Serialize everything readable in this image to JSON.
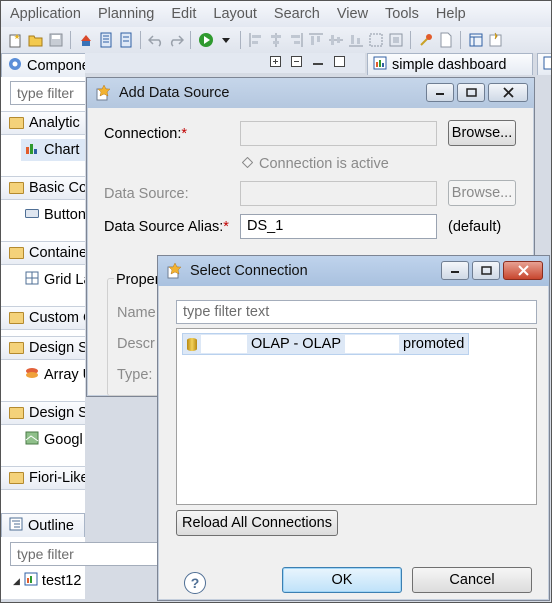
{
  "menu": [
    "Application",
    "Planning",
    "Edit",
    "Layout",
    "Search",
    "View",
    "Tools",
    "Help"
  ],
  "toolbar_icons": [
    "new-icon",
    "open-icon",
    "save-icon",
    "deploy-icon",
    "grid-icon",
    "list-icon",
    "undo-icon",
    "redo-icon",
    "run-icon",
    "dropdown-icon",
    "align-left-icon",
    "align-center-icon",
    "align-right-icon",
    "align-top-icon",
    "align-middle-icon",
    "align-bottom-icon",
    "resize-icon",
    "fit-icon",
    "pin-icon",
    "page-icon",
    "layout-icon",
    "script-icon"
  ],
  "components_panel": {
    "tab_label": "Components",
    "filter_placeholder": "type filter",
    "categories": [
      {
        "label": "Analytic",
        "items": [
          {
            "label": "Chart",
            "selected": true
          }
        ]
      },
      {
        "label": "Basic Co",
        "items": [
          {
            "label": "Button"
          }
        ]
      },
      {
        "label": "Containe",
        "items": [
          {
            "label": "Grid La"
          }
        ]
      },
      {
        "label": "Custom C",
        "items": []
      },
      {
        "label": "Design S",
        "items": [
          {
            "label": "Array U"
          }
        ]
      },
      {
        "label": "Design S",
        "items": [
          {
            "label": "Googl"
          }
        ]
      },
      {
        "label": "Fiori-Like",
        "items": []
      }
    ]
  },
  "outline_panel": {
    "tab_label": "Outline",
    "filter_placeholder": "type filter",
    "tree_item": "test12"
  },
  "editor_tab": {
    "label": "simple dashboard"
  },
  "add_data_source": {
    "title": "Add Data Source",
    "connection_label": "Connection:",
    "required_mark": "*",
    "browse_label": "Browse...",
    "connection_active_label": "Connection is active",
    "data_source_label": "Data Source:",
    "browse_disabled_label": "Browse...",
    "alias_label": "Data Source Alias:",
    "alias_value": "DS_1",
    "alias_note": "(default)",
    "properties_group_label": "Proper",
    "prop_name_label": "Name",
    "prop_desc_label": "Descr",
    "prop_type_label": "Type:"
  },
  "select_connection": {
    "title": "Select Connection",
    "filter_placeholder": "type filter text",
    "connection_item": {
      "part1": "OLAP - OLAP",
      "part2": "promoted"
    },
    "reload_label": "Reload All Connections",
    "ok_label": "OK",
    "cancel_label": "Cancel"
  }
}
